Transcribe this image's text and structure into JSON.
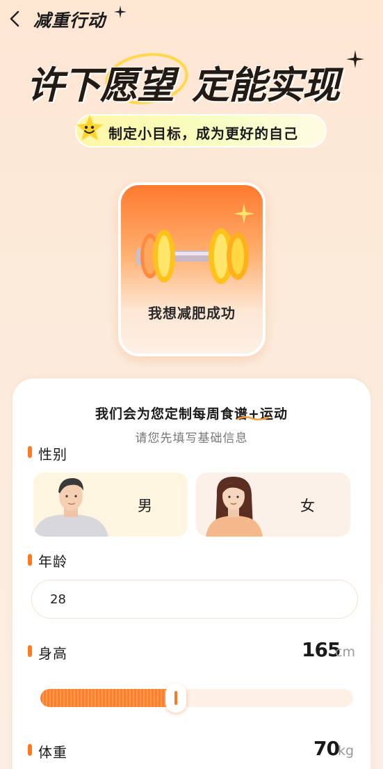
{
  "header": {
    "title": "减重行动",
    "back_icon": "chevron-left-icon"
  },
  "hero": {
    "title_part1": "许下愿望",
    "title_part2": "定能实现",
    "slogan": "制定小目标，成为更好的自己"
  },
  "goal": {
    "label": "我想减肥成功",
    "icon": "dumbbell-icon"
  },
  "form": {
    "title": "我们会为您定制每周食谱+运动",
    "subtitle": "请您先填写基础信息",
    "gender": {
      "label": "性别",
      "options": [
        "男",
        "女"
      ]
    },
    "age": {
      "label": "年龄",
      "value": "28"
    },
    "height": {
      "label": "身高",
      "value": "165",
      "unit": "cm",
      "fill_fraction": 0.43
    },
    "weight": {
      "label": "体重",
      "value": "70",
      "unit": "kg"
    }
  },
  "colors": {
    "accent": "#ff7a1e",
    "background": "#fde6d2",
    "card": "#ffffff"
  }
}
